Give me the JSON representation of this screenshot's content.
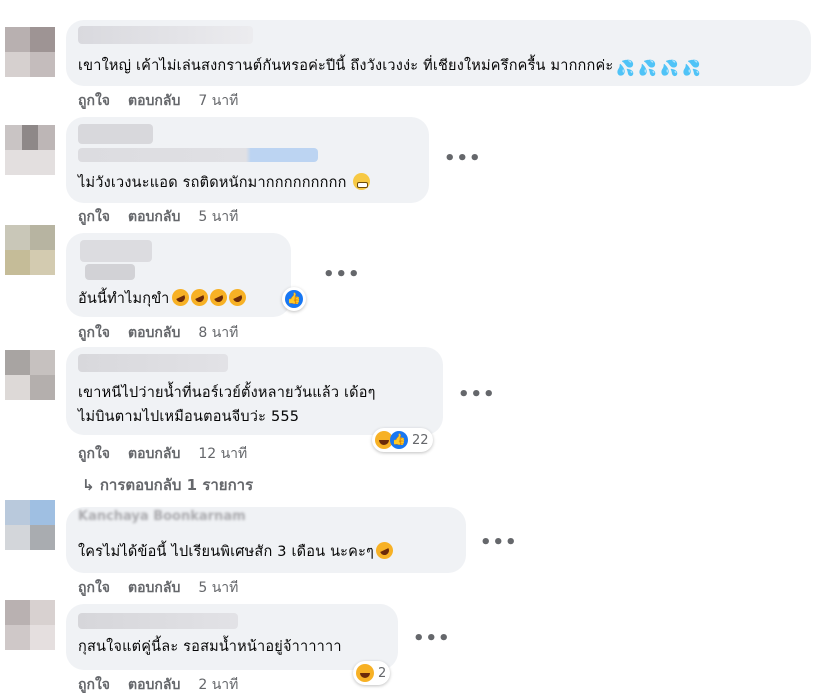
{
  "top_partial_text": "...",
  "menu_glyph": "•••",
  "reply_arrow": "↳",
  "icons": {
    "emoji_drops": "💦",
    "like": "👍"
  },
  "colors": {
    "bubble": "#f0f2f5",
    "action_text": "#65676b",
    "like_blue": "#1877f2",
    "haha_yellow": "#f7b125"
  },
  "actions": {
    "like": "ถูกใจ",
    "reply": "ตอบกลับ"
  },
  "comments": [
    {
      "text": "เขาใหญ่ เค้าไม่เล่นสงกรานต์กันหรอค่ะปีนี้ ถึงวังเวงง่ะ ที่เชียงใหม่ครึกครื้น มากกกค่ะ",
      "time": "7 นาที"
    },
    {
      "text": "ไม่วังเวงนะแอด รถติดหนักมากกกกกกกกก",
      "time": "5 นาที"
    },
    {
      "text": "อันนี้ทำไมกุขำ",
      "time": "8 นาที"
    },
    {
      "text_line1": "เขาหนีไปว่ายน้ำที่นอร์เวย์ตั้งหลายวันแล้ว เด้อๆ",
      "text_line2": "ไม่บินตามไปเหมือนตอนจีบว่ะ 555",
      "time": "12 นาที",
      "reaction_count": "22",
      "replies_label": "การตอบกลับ 1 รายการ"
    },
    {
      "name_partial": "Kanchaya Boonkarnam",
      "text": "ใครไม่ได้ข้อนี้ ไปเรียนพิเศษสัก 3 เดือน นะคะๆ",
      "time": "5 นาที"
    },
    {
      "text": "กุสนใจแต่คู่นี้ละ รอสมน้ำหน้าอยู่จ้าาาาาา",
      "time": "2 นาที",
      "reaction_count": "2"
    }
  ]
}
